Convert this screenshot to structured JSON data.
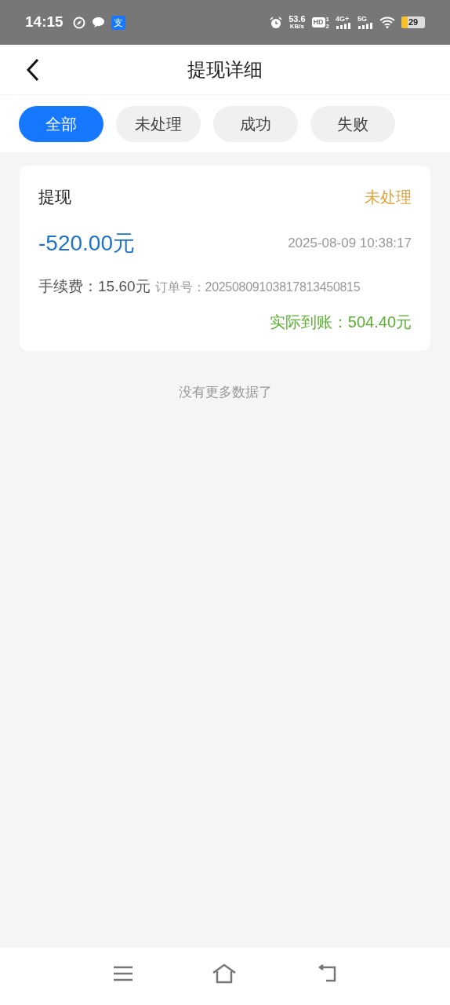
{
  "status_bar": {
    "time": "14:15",
    "app_badge": "支",
    "net_speed": "53.6",
    "net_unit": "KB/s",
    "hd": "HD",
    "hd_sims": [
      "1",
      "2"
    ],
    "network_1": "4G+",
    "network_2": "5G",
    "battery": "29"
  },
  "header": {
    "title": "提现详细"
  },
  "tabs": [
    {
      "label": "全部",
      "selected": true
    },
    {
      "label": "未处理",
      "selected": false
    },
    {
      "label": "成功",
      "selected": false
    },
    {
      "label": "失败",
      "selected": false
    }
  ],
  "records": [
    {
      "type": "提现",
      "status": "未处理",
      "color": "#e6a23c",
      "amount": "-520.00元",
      "time": "2025-08-09 10:38:17",
      "fee_label": "手续费：",
      "fee": "15.60元",
      "order_label": "订单号：",
      "order_no": "20250809103817813450815",
      "received": "实际到账：504.40元"
    }
  ],
  "footer_note": "没有更多数据了"
}
